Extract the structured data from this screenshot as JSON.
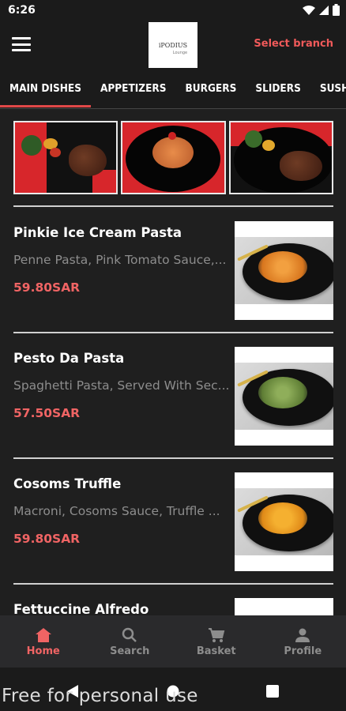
{
  "status": {
    "time": "6:26"
  },
  "header": {
    "select_branch": "Select branch",
    "logo_text": "iPODIUS",
    "logo_sub": "Lounge"
  },
  "tabs": [
    {
      "label": "MAIN DISHES",
      "active": true
    },
    {
      "label": "APPETIZERS",
      "active": false
    },
    {
      "label": "BURGERS",
      "active": false
    },
    {
      "label": "SLIDERS",
      "active": false
    },
    {
      "label": "SUSHI",
      "active": false
    }
  ],
  "dishes": [
    {
      "name": "Pinkie Ice Cream Pasta",
      "description": "Penne Pasta, Pink Tomato Sauce,...",
      "price": "59.80SAR"
    },
    {
      "name": "Pesto Da Pasta",
      "description": "Spaghetti Pasta, Served With Sec...",
      "price": "57.50SAR"
    },
    {
      "name": "Cosoms Truffle",
      "description": "Macroni, Cosoms Sauce, Truffle ...",
      "price": "59.80SAR"
    },
    {
      "name": "Fettuccine Alfredo",
      "description": "",
      "price": ""
    }
  ],
  "bottom_nav": [
    {
      "label": "Home",
      "icon": "home-icon",
      "active": true
    },
    {
      "label": "Search",
      "icon": "search-icon",
      "active": false
    },
    {
      "label": "Basket",
      "icon": "cart-icon",
      "active": false
    },
    {
      "label": "Profile",
      "icon": "person-icon",
      "active": false
    }
  ],
  "watermark": "Free for personal use",
  "colors": {
    "accent": "#f06464",
    "background": "#1f1f1f",
    "muted": "#8d8d8d"
  }
}
